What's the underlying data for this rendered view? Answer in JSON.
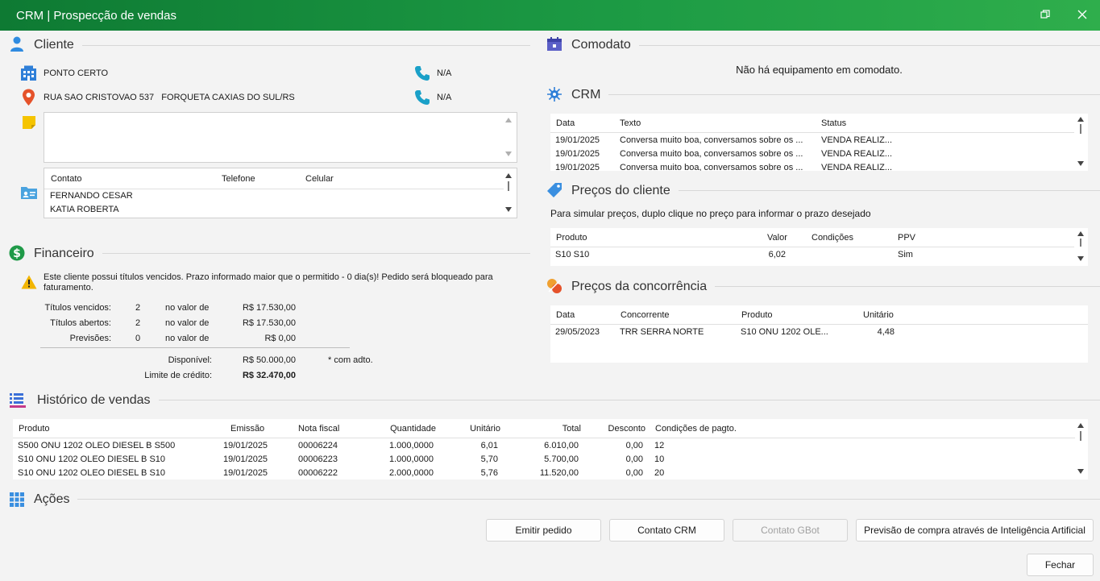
{
  "window": {
    "title": "CRM | Prospecção de vendas"
  },
  "cliente": {
    "section_title": "Cliente",
    "nome": "PONTO CERTO",
    "endereco": "RUA SAO CRISTOVAO 537   FORQUETA CAXIAS DO SUL/RS",
    "telefone1": "N/A",
    "telefone2": "N/A",
    "observacao": "",
    "contatos": {
      "headers": [
        "Contato",
        "Telefone",
        "Celular"
      ],
      "rows": [
        [
          "FERNANDO CESAR",
          "",
          ""
        ],
        [
          "KATIA ROBERTA",
          "",
          ""
        ]
      ]
    }
  },
  "financeiro": {
    "section_title": "Financeiro",
    "aviso": "Este cliente possui títulos vencidos. Prazo informado maior que o permitido - 0 dia(s)! Pedido será bloqueado para faturamento.",
    "rows": [
      {
        "label": "Títulos vencidos:",
        "qtd": "2",
        "mid": "no valor de",
        "valor": "R$ 17.530,00"
      },
      {
        "label": "Títulos abertos:",
        "qtd": "2",
        "mid": "no valor de",
        "valor": "R$ 17.530,00"
      },
      {
        "label": "Previsões:",
        "qtd": "0",
        "mid": "no valor de",
        "valor": "R$ 0,00"
      }
    ],
    "disponivel_label": "Disponível:",
    "disponivel_valor": "R$ 50.000,00",
    "adto_note": "* com adto.",
    "limite_label": "Limite de crédito:",
    "limite_valor": "R$ 32.470,00"
  },
  "comodato": {
    "section_title": "Comodato",
    "mensagem": "Não há equipamento em comodato."
  },
  "crm": {
    "section_title": "CRM",
    "headers": [
      "Data",
      "Texto",
      "Status"
    ],
    "rows": [
      [
        "19/01/2025",
        "Conversa muito boa, conversamos sobre os ...",
        "VENDA REALIZ..."
      ],
      [
        "19/01/2025",
        "Conversa muito boa, conversamos sobre os ...",
        "VENDA REALIZ..."
      ],
      [
        "19/01/2025",
        "Conversa muito boa, conversamos sobre os ...",
        "VENDA REALIZ..."
      ]
    ]
  },
  "precos_cliente": {
    "section_title": "Preços do cliente",
    "instrucao": "Para simular preços, duplo clique no preço para informar o prazo desejado",
    "headers": [
      "Produto",
      "Valor",
      "Condições",
      "PPV"
    ],
    "rows": [
      [
        "S10 S10",
        "6,02",
        "",
        "Sim"
      ]
    ]
  },
  "precos_concorrencia": {
    "section_title": "Preços da concorrência",
    "headers": [
      "Data",
      "Concorrente",
      "Produto",
      "Unitário"
    ],
    "rows": [
      [
        "29/05/2023",
        "TRR SERRA NORTE",
        "S10 ONU 1202 OLE...",
        "4,48"
      ]
    ]
  },
  "historico": {
    "section_title": "Histórico de vendas",
    "headers": [
      "Produto",
      "Emissão",
      "Nota fiscal",
      "Quantidade",
      "Unitário",
      "Total",
      "Desconto",
      "Condições de pagto."
    ],
    "rows": [
      [
        "S500 ONU 1202 OLEO DIESEL B S500",
        "19/01/2025",
        "00006224",
        "1.000,0000",
        "6,01",
        "6.010,00",
        "0,00",
        "12"
      ],
      [
        "S10 ONU 1202 OLEO DIESEL B S10",
        "19/01/2025",
        "00006223",
        "1.000,0000",
        "5,70",
        "5.700,00",
        "0,00",
        "10"
      ],
      [
        "S10 ONU 1202 OLEO DIESEL B S10",
        "19/01/2025",
        "00006222",
        "2.000,0000",
        "5,76",
        "11.520,00",
        "0,00",
        "20"
      ]
    ]
  },
  "acoes": {
    "section_title": "Ações",
    "emitir_pedido": "Emitir pedido",
    "contato_crm": "Contato CRM",
    "contato_gbot": "Contato GBot",
    "previsao_ia": "Previsão de compra através de Inteligência Artificial",
    "fechar": "Fechar"
  },
  "colors": {
    "titlebar": "#1c9a44",
    "accent_blue": "#2f7fd8",
    "warning": "#f2b500"
  }
}
